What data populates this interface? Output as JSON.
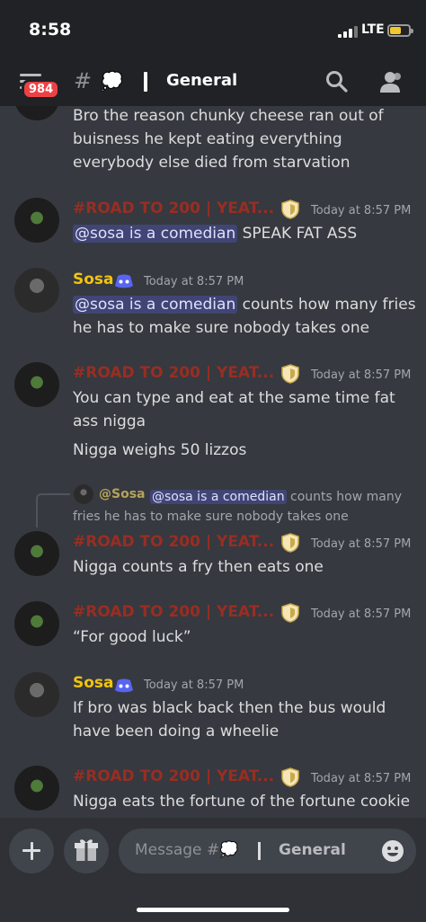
{
  "status_bar": {
    "time": "8:58",
    "network": "LTE"
  },
  "header": {
    "badge": "984",
    "hash": "#",
    "channel_emoji": "💭",
    "channel_name": "General"
  },
  "messages": [
    {
      "text": "Bro the reason chunky cheese ran out of buisness he kept eating everything everybody else died from starvation"
    },
    {
      "author": "#ROAD TO 200 | YEAT...",
      "time": "Today at 8:57 PM",
      "mention": "@sosa is a comedian",
      "text": " SPEAK FAT ASS"
    },
    {
      "author": "Sosa",
      "time": "Today at 8:57 PM",
      "mention": "@sosa is a comedian",
      "text": "  counts how many fries he has to make sure nobody takes one"
    },
    {
      "author": "#ROAD TO 200 | YEAT...",
      "time": "Today at 8:57 PM",
      "text": "You can type and eat at the same time fat ass nigga",
      "text2": "Nigga weighs 50 lizzos"
    },
    {
      "reply_author": "@Sosa",
      "reply_mention": "@sosa is a comedian",
      "reply_text": " counts how many fries he has to make sure nobody takes one",
      "author": "#ROAD TO 200 | YEAT...",
      "time": "Today at 8:57 PM",
      "text": "Nigga counts a fry then eats one"
    },
    {
      "author": "#ROAD TO 200 | YEAT...",
      "time": "Today at 8:57 PM",
      "text": "“For good luck”"
    },
    {
      "author": "Sosa",
      "time": "Today at 8:57 PM",
      "text": "If bro was black back then the bus would have been doing a wheelie"
    },
    {
      "author": "#ROAD TO 200 | YEAT...",
      "time": "Today at 8:57 PM",
      "text": "Nigga eats the fortune of the fortune cookie"
    }
  ],
  "composer": {
    "placeholder_prefix": "Message #💭",
    "placeholder_channel": "General"
  },
  "colors": {
    "background": "#36393f",
    "header": "#202225",
    "road_role": "#992d22",
    "sosa_role": "#f1c40f",
    "badge": "#ed4245",
    "mention": "#5865f2"
  },
  "icons": [
    "hamburger-icon",
    "search-icon",
    "members-icon",
    "role-shield-icon",
    "bot-icon",
    "plus-icon",
    "gift-icon",
    "emoji-icon"
  ]
}
